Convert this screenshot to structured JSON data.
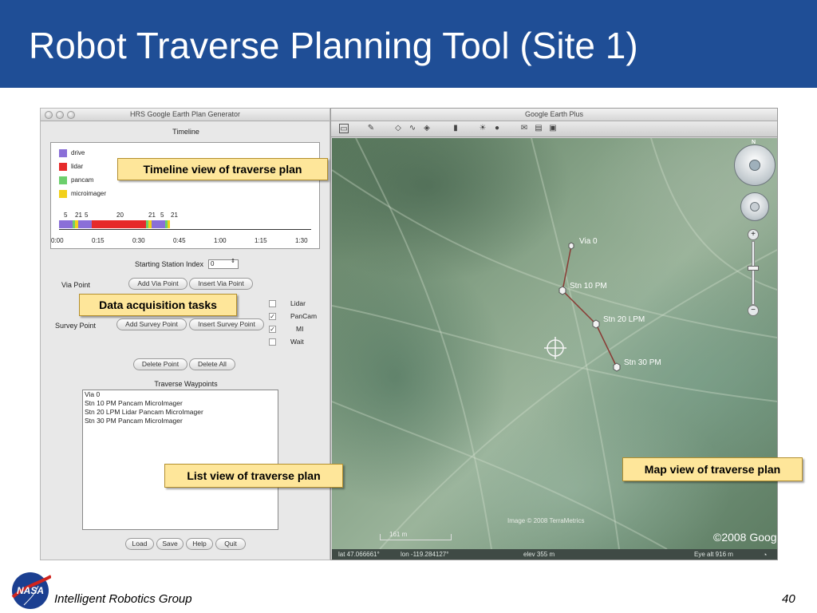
{
  "slide": {
    "title": "Robot Traverse Planning Tool (Site 1)",
    "footer": "Intelligent Robotics Group",
    "page_number": "40",
    "logo_text": "NASA",
    "colors": {
      "title_bar": "#1f4e96",
      "callout_bg": "#fee69a"
    }
  },
  "left_window": {
    "title": "HRS Google Earth Plan Generator",
    "timeline": {
      "heading": "Timeline",
      "legend": [
        {
          "label": "drive",
          "color": "#8a6fd8"
        },
        {
          "label": "lidar",
          "color": "#e62a2a"
        },
        {
          "label": "pancam",
          "color": "#6ccf6c"
        },
        {
          "label": "microimager",
          "color": "#f2d01a"
        }
      ],
      "durations": [
        "5",
        "21",
        "5",
        "20",
        "21",
        "5",
        "21"
      ],
      "segments": [
        {
          "activity": "drive",
          "minutes": 5
        },
        {
          "activity": "pancam",
          "minutes": 1
        },
        {
          "activity": "microimager",
          "minutes": 1
        },
        {
          "activity": "drive",
          "minutes": 5
        },
        {
          "activity": "lidar",
          "minutes": 20
        },
        {
          "activity": "pancam",
          "minutes": 1
        },
        {
          "activity": "microimager",
          "minutes": 1
        },
        {
          "activity": "drive",
          "minutes": 5
        },
        {
          "activity": "pancam",
          "minutes": 1
        },
        {
          "activity": "microimager",
          "minutes": 1
        }
      ],
      "ticks": [
        "0:00",
        "0:15",
        "0:30",
        "0:45",
        "1:00",
        "1:15",
        "1:30"
      ]
    },
    "starting_station_label": "Starting Station Index",
    "starting_station_value": "0",
    "via_point_label": "Via Point",
    "survey_point_label": "Survey Point",
    "buttons": {
      "add_via": "Add Via Point",
      "insert_via": "Insert Via Point",
      "add_survey": "Add Survey Point",
      "insert_survey": "Insert Survey Point",
      "delete_point": "Delete Point",
      "delete_all": "Delete All",
      "load": "Load",
      "save": "Save",
      "help": "Help",
      "quit": "Quit"
    },
    "tasks": [
      {
        "label": "Lidar",
        "checked": false
      },
      {
        "label": "PanCam",
        "checked": true
      },
      {
        "label": "MI",
        "checked": true
      },
      {
        "label": "Wait",
        "checked": false
      }
    ],
    "waypoints_heading": "Traverse Waypoints",
    "waypoints": [
      "Via 0",
      "Stn 10 PM Pancam MicroImager",
      "Stn 20 LPM Lidar Pancam MicroImager",
      "Stn 30 PM Pancam MicroImager"
    ]
  },
  "right_window": {
    "title": "Google Earth Plus",
    "waypoints": [
      {
        "label": "Via 0"
      },
      {
        "label": "Stn 10 PM"
      },
      {
        "label": "Stn 20 LPM"
      },
      {
        "label": "Stn 30 PM"
      }
    ],
    "credit": "Image © 2008 TerraMetrics",
    "scale": "161 m",
    "brand": "©2008 Google",
    "status": {
      "lat": "lat  47.066661°",
      "lon": "lon -119.284127°",
      "elev": "elev  355 m",
      "eye_alt": "Eye alt     916 m"
    }
  },
  "callouts": {
    "timeline": "Timeline view of traverse plan",
    "tasks": "Data acquisition tasks",
    "list": "List view of traverse plan",
    "map": "Map view of traverse plan"
  }
}
